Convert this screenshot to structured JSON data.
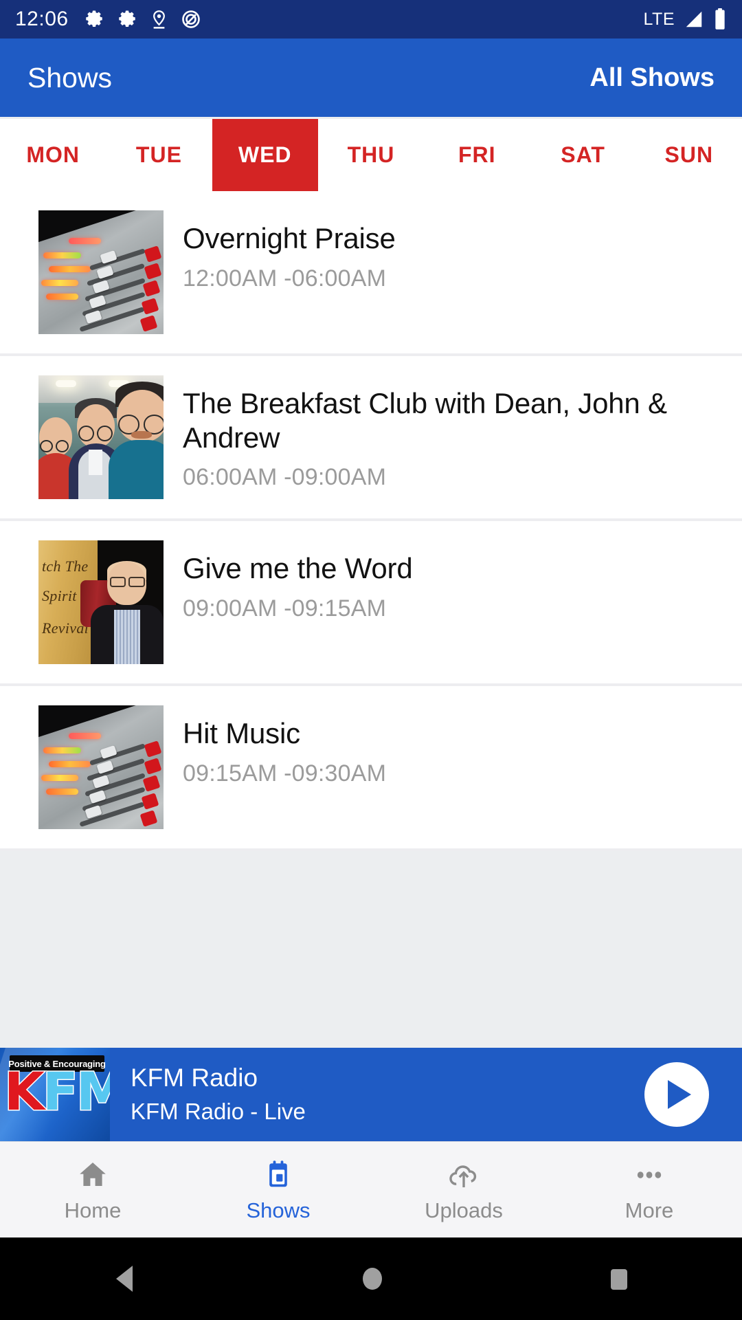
{
  "status_bar": {
    "time": "12:06",
    "network": "LTE",
    "icons": [
      "gear-icon",
      "gear-icon",
      "location-pin-icon",
      "do-not-disturb-icon",
      "signal-icon",
      "battery-icon"
    ]
  },
  "app_bar": {
    "title": "Shows",
    "action_label": "All Shows"
  },
  "day_tabs": {
    "selected": "WED",
    "items": [
      {
        "label": "MON",
        "active": false
      },
      {
        "label": "TUE",
        "active": false
      },
      {
        "label": "WED",
        "active": true
      },
      {
        "label": "THU",
        "active": false
      },
      {
        "label": "FRI",
        "active": false
      },
      {
        "label": "SAT",
        "active": false
      },
      {
        "label": "SUN",
        "active": false
      }
    ]
  },
  "shows": [
    {
      "title": "Overnight Praise",
      "time": "12:00AM -06:00AM",
      "thumbnail": "audio-mixing-console-photo"
    },
    {
      "title": "The Breakfast Club with Dean, John & Andrew",
      "time": "06:00AM -09:00AM",
      "thumbnail": "three-hosts-selfie-photo"
    },
    {
      "title": "Give me the Word",
      "time": "09:00AM -09:15AM",
      "thumbnail": "preacher-catch-the-spirit-revival-photo",
      "thumbnail_text": [
        "tch The",
        "Spirit",
        "Revival"
      ]
    },
    {
      "title": "Hit Music",
      "time": "09:15AM -09:30AM",
      "thumbnail": "audio-mixing-console-photo"
    }
  ],
  "player": {
    "logo_tagline": "Positive & Encouraging",
    "logo_k": "K",
    "logo_fm": "FM",
    "station": "KFM Radio",
    "now_playing": "KFM Radio - Live",
    "play_button": "play-icon"
  },
  "bottom_nav": {
    "items": [
      {
        "label": "Home",
        "icon": "home-icon",
        "active": false
      },
      {
        "label": "Shows",
        "icon": "calendar-icon",
        "active": true
      },
      {
        "label": "Uploads",
        "icon": "cloud-upload-icon",
        "active": false
      },
      {
        "label": "More",
        "icon": "more-dots-icon",
        "active": false
      }
    ]
  },
  "android_nav": {
    "back": "back-triangle-icon",
    "home": "home-circle-icon",
    "recents": "recents-square-icon"
  },
  "colors": {
    "status_bar": "#16307a",
    "app_bar": "#1f5bc4",
    "accent_red": "#d42424",
    "accent_blue": "#2563d9",
    "time_text": "#9b9b9b",
    "page_bg": "#eceef0"
  }
}
